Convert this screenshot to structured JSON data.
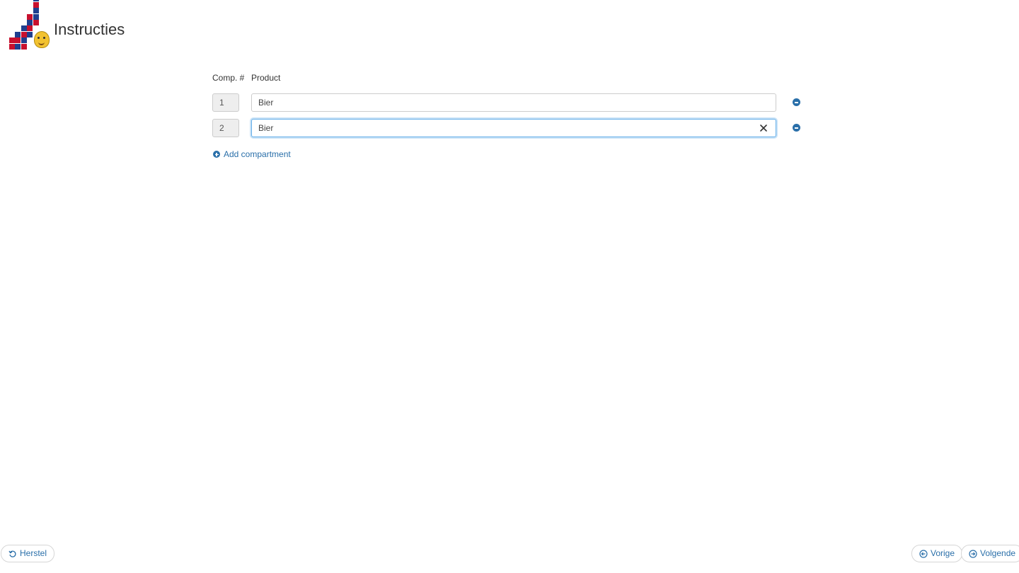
{
  "header": {
    "title": "Instructies",
    "logo_icon": "stacked-boxes-logo-icon"
  },
  "table": {
    "headers": {
      "number": "Comp. #",
      "product": "Product"
    },
    "rows": [
      {
        "number": "1",
        "product": "Bier",
        "focused": false
      },
      {
        "number": "2",
        "product": "Bier",
        "focused": true
      }
    ],
    "add_label": "Add compartment"
  },
  "footer": {
    "reset_label": "Herstel",
    "prev_label": "Vorige",
    "next_label": "Volgende"
  },
  "colors": {
    "accent": "#2a6fa9",
    "focus_border": "#66afe9",
    "logo_red": "#c8102e",
    "logo_blue": "#1f3f8f",
    "logo_yellow": "#f2c230"
  }
}
